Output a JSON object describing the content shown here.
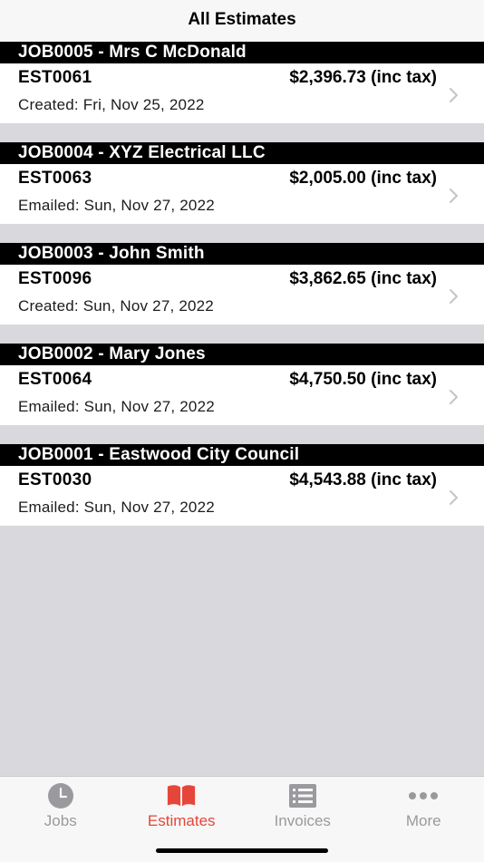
{
  "header": {
    "title": "All Estimates"
  },
  "estimates": [
    {
      "job": "JOB0005 - Mrs C McDonald",
      "number": "EST0061",
      "amount": "$2,396.73 (inc tax)",
      "status": "Created: Fri, Nov 25, 2022"
    },
    {
      "job": "JOB0004 - XYZ Electrical LLC",
      "number": "EST0063",
      "amount": "$2,005.00 (inc tax)",
      "status": "Emailed: Sun, Nov 27, 2022"
    },
    {
      "job": "JOB0003 - John Smith",
      "number": "EST0096",
      "amount": "$3,862.65 (inc tax)",
      "status": "Created: Sun, Nov 27, 2022"
    },
    {
      "job": "JOB0002 - Mary Jones",
      "number": "EST0064",
      "amount": "$4,750.50 (inc tax)",
      "status": "Emailed: Sun, Nov 27, 2022"
    },
    {
      "job": "JOB0001 - Eastwood City Council",
      "number": "EST0030",
      "amount": "$4,543.88 (inc tax)",
      "status": "Emailed: Sun, Nov 27, 2022"
    }
  ],
  "tabs": [
    {
      "label": "Jobs",
      "icon": "clock-icon",
      "active": false
    },
    {
      "label": "Estimates",
      "icon": "book-icon",
      "active": true
    },
    {
      "label": "Invoices",
      "icon": "list-icon",
      "active": false
    },
    {
      "label": "More",
      "icon": "ellipsis-icon",
      "active": false
    }
  ],
  "colors": {
    "accent": "#e6463a",
    "inactive": "#9a9a9e",
    "header_bg": "#000000",
    "background": "#d8d8dd"
  }
}
